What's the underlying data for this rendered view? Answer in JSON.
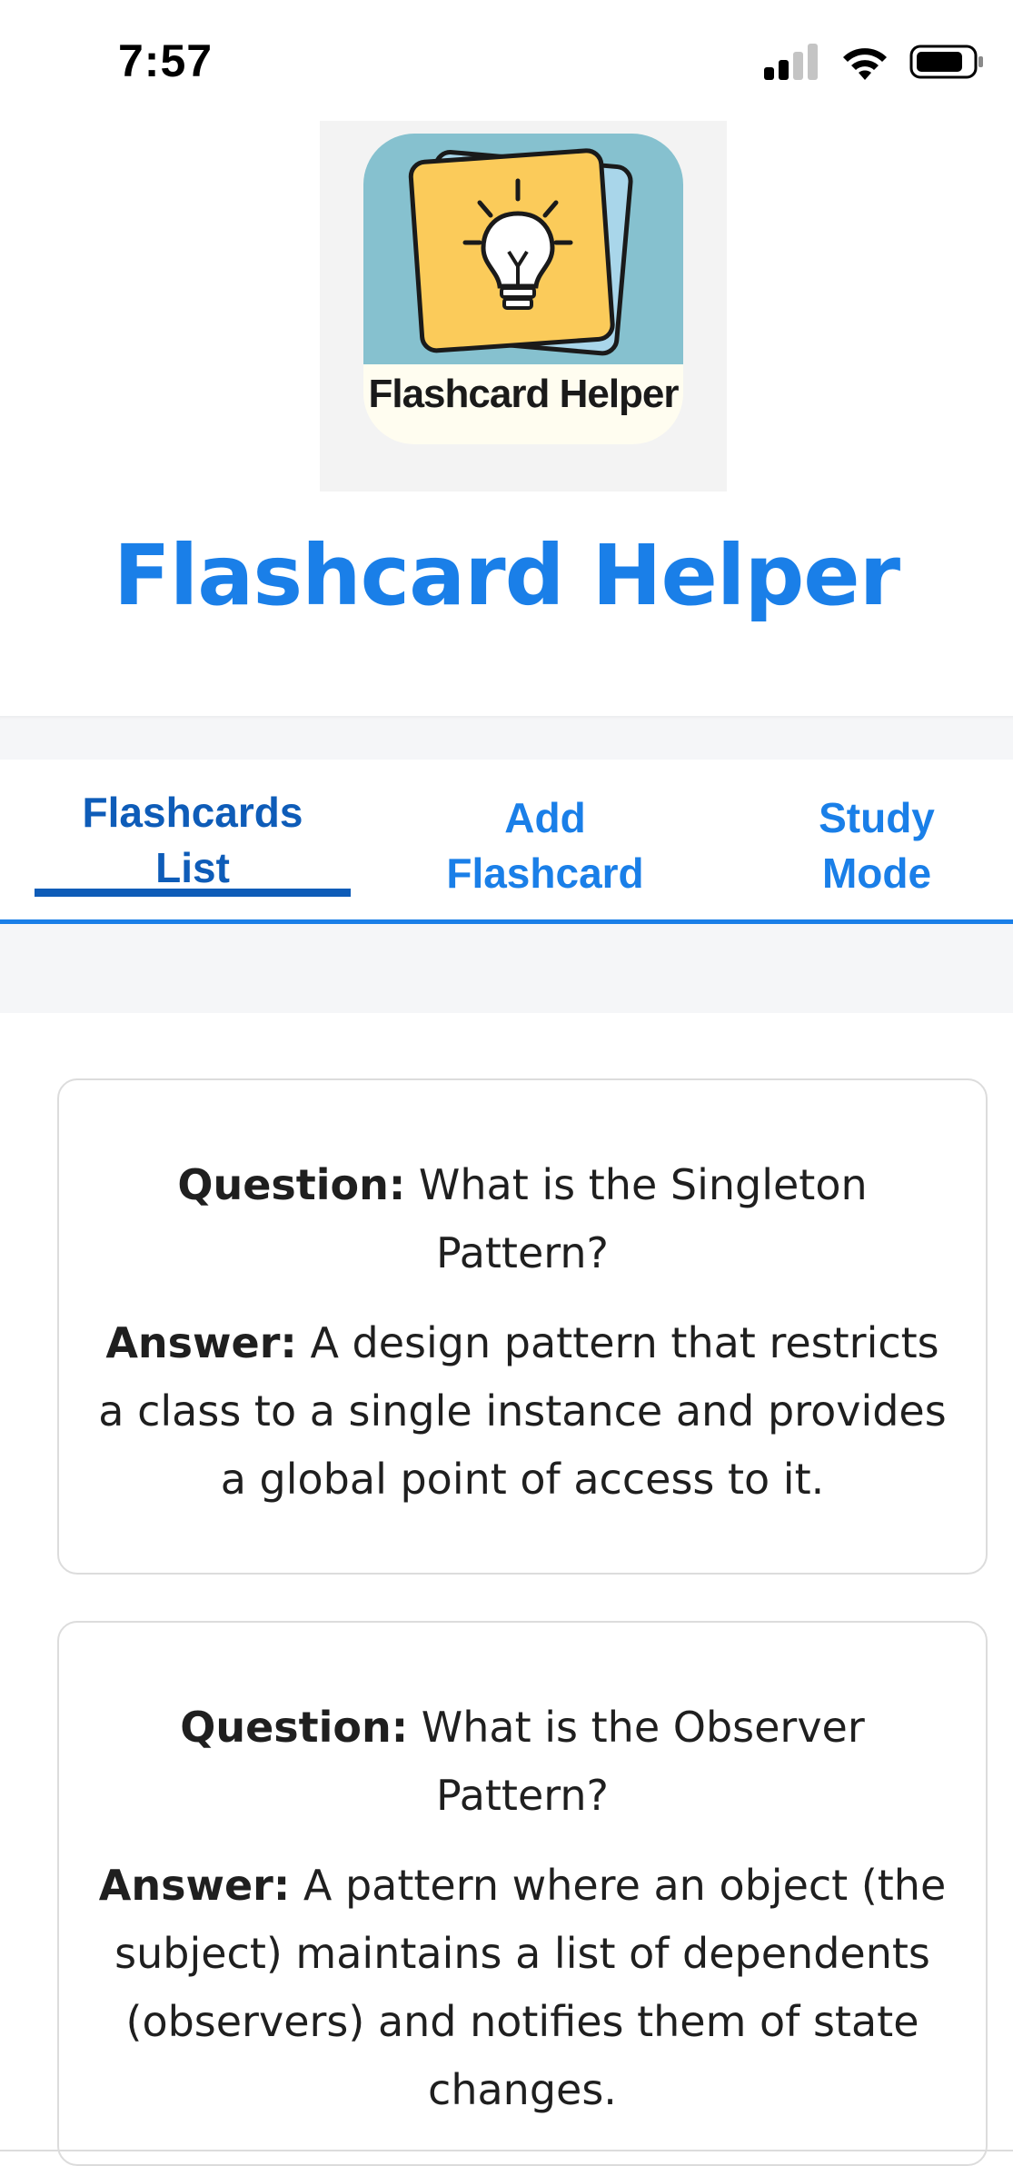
{
  "status_bar": {
    "time": "7:57"
  },
  "logo": {
    "text": "Flashcard Helper",
    "colors": {
      "card_top": "#86c1cf",
      "card_bottom": "#fffdf0",
      "flashcard_front": "#fbcb5a",
      "flashcard_back": "#a9d6ea"
    },
    "icon": "lightbulb-icon"
  },
  "app": {
    "title": "Flashcard Helper",
    "accent_color": "#1a7fe8"
  },
  "tabs": [
    {
      "label_line1": "Flashcards",
      "label_line2": "List",
      "active": true
    },
    {
      "label_line1": "Add",
      "label_line2": "Flashcard",
      "active": false
    },
    {
      "label_line1": "Study",
      "label_line2": "Mode",
      "active": false
    }
  ],
  "flashcards": [
    {
      "question_label": "Question:",
      "question": "What is the Singleton Pattern?",
      "answer_label": "Answer:",
      "answer": "A design pattern that restricts a class to a single instance and provides a global point of access to it."
    },
    {
      "question_label": "Question:",
      "question": "What is the Observer Pattern?",
      "answer_label": "Answer:",
      "answer": "A pattern where an object (the subject) maintains a list of dependents (observers) and notifies them of state changes."
    }
  ]
}
